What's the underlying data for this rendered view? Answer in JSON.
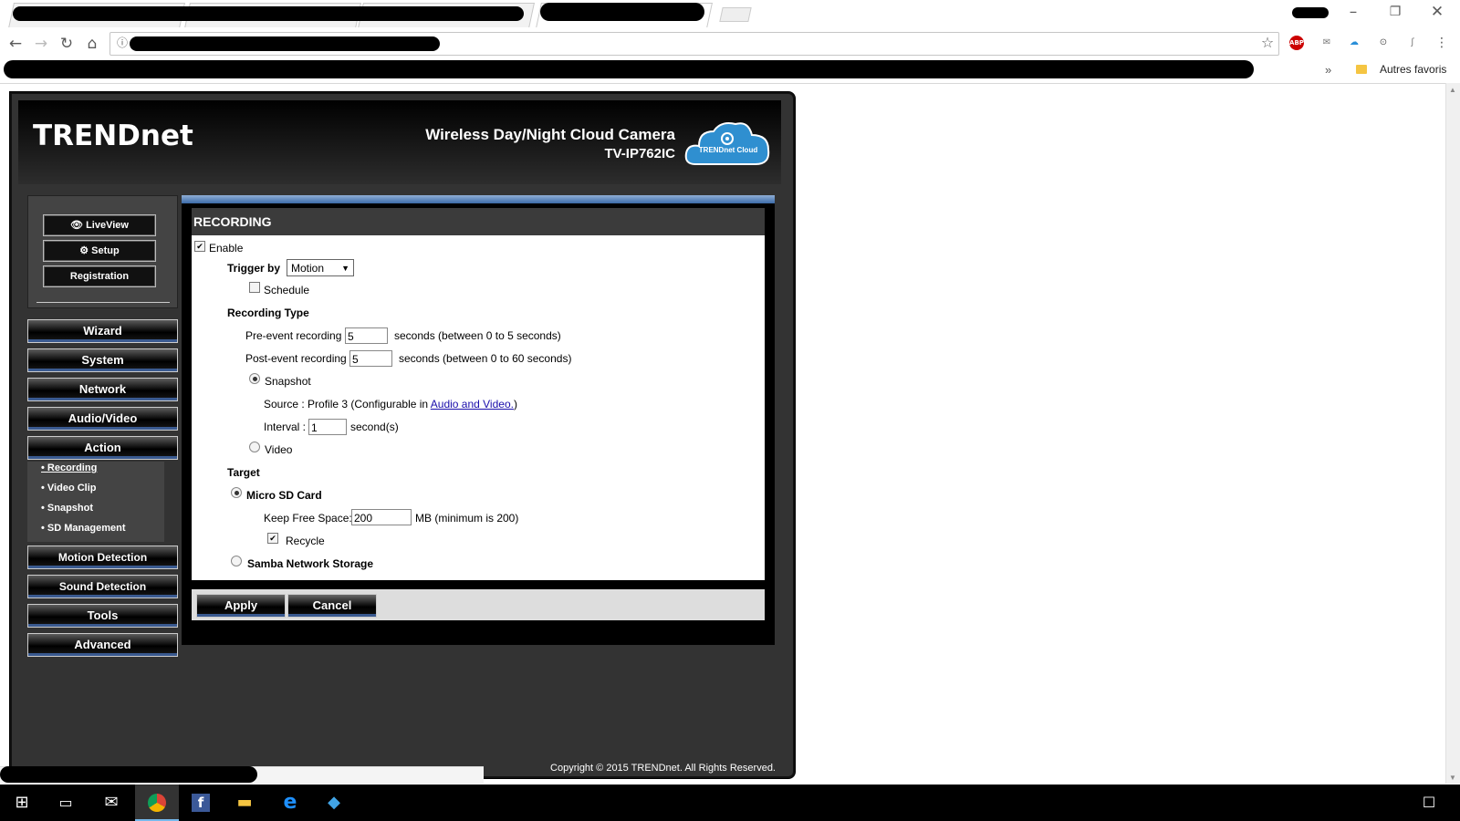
{
  "browser": {
    "bookmarks": {
      "overflow": "»",
      "other_bookmarks": "Autres favoris"
    },
    "extensions": [
      "ABP"
    ]
  },
  "camera": {
    "brand": "TRENDnet",
    "product_title": "Wireless Day/Night Cloud Camera",
    "model": "TV-IP762IC",
    "cloud_badge": "TRENDnet Cloud",
    "copyright": "Copyright © 2015  TRENDnet. All Rights Reserved."
  },
  "quick_buttons": {
    "live_view": "LiveView",
    "setup": "Setup",
    "registration": "Registration"
  },
  "nav": {
    "wizard": "Wizard",
    "system": "System",
    "network": "Network",
    "audio_video": "Audio/Video",
    "action": "Action",
    "action_items": [
      "• Recording",
      "• Video Clip",
      "• Snapshot",
      "• SD Management"
    ],
    "motion_detection": "Motion Detection",
    "sound_detection": "Sound Detection",
    "tools": "Tools",
    "advanced": "Advanced"
  },
  "recording": {
    "title": "RECORDING",
    "enable_label": "Enable",
    "enable_checked": true,
    "trigger_label": "Trigger by",
    "trigger_value": "Motion",
    "schedule_label": "Schedule",
    "recording_type_label": "Recording Type",
    "pre_event_label": "Pre-event recording",
    "pre_event_value": "5",
    "pre_event_hint": "seconds  (between 0 to 5 seconds)",
    "post_event_label": "Post-event recording",
    "post_event_value": "5",
    "post_event_hint": "seconds  (between 0 to 60 seconds)",
    "snapshot_label": "Snapshot",
    "source_text": "Source : Profile 3  (Configurable in",
    "source_link": "Audio and Video.",
    "source_close": ")",
    "interval_label": "Interval :",
    "interval_value": "1",
    "interval_unit": "second(s)",
    "video_label": "Video",
    "target_label": "Target",
    "micro_sd_label": "Micro SD Card",
    "keep_free_label": "Keep Free Space:",
    "keep_free_value": "200",
    "keep_free_hint": "MB (minimum is 200)",
    "recycle_label": "Recycle",
    "samba_label": "Samba Network Storage"
  },
  "actions": {
    "apply": "Apply",
    "cancel": "Cancel"
  },
  "colors": {
    "accent": "#3c6ba8",
    "panel_dark": "#333333",
    "link": "#1a0dab"
  }
}
